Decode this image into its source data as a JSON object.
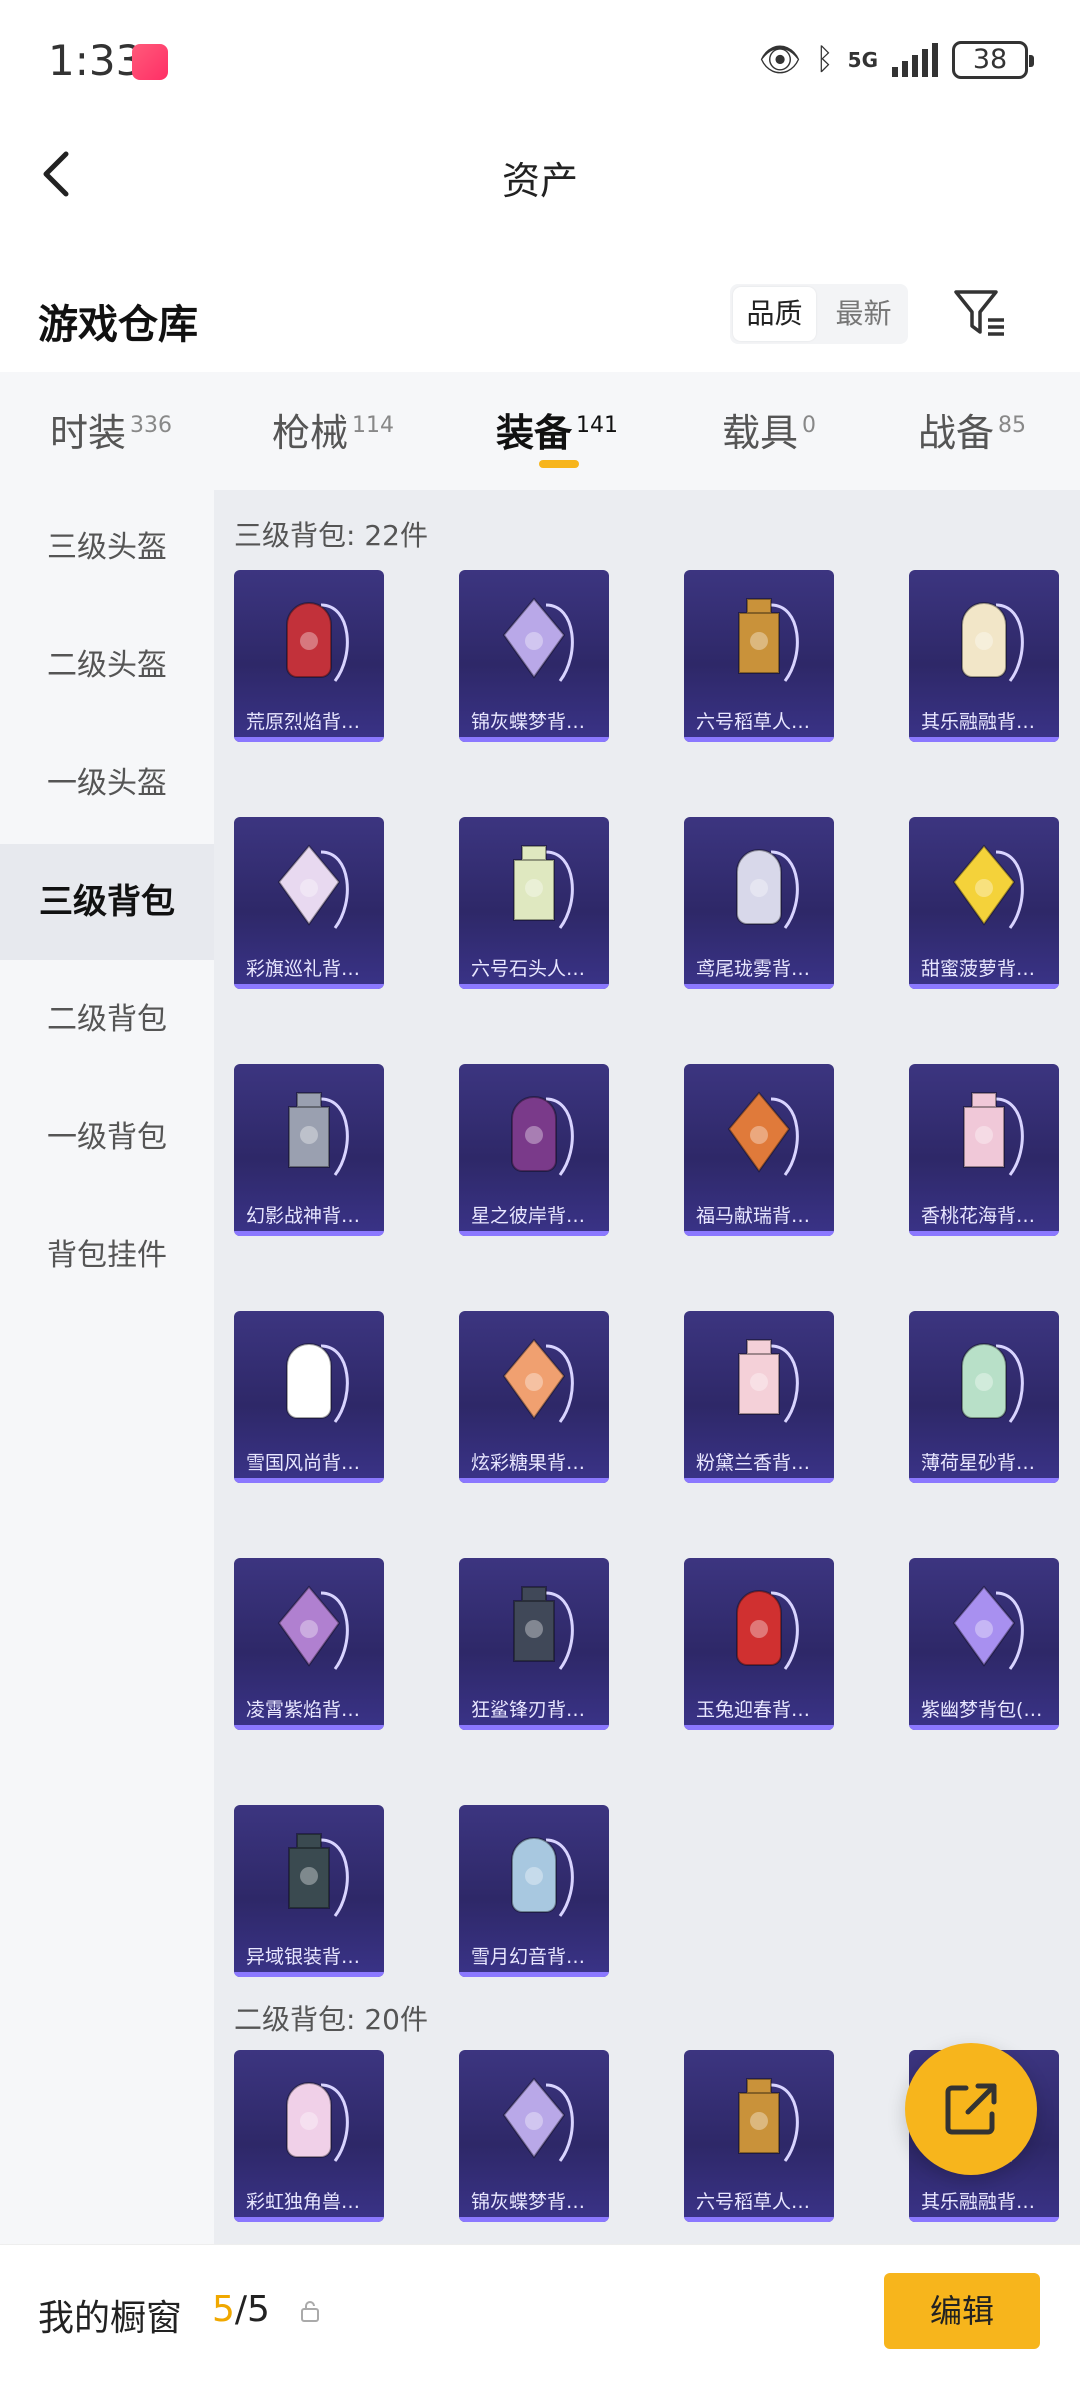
{
  "status": {
    "time": "1:33",
    "network": "5G",
    "battery": "38"
  },
  "nav": {
    "title": "资产"
  },
  "warehouse": {
    "title": "游戏仓库",
    "sort_options": [
      "品质",
      "最新"
    ],
    "active_sort": "品质"
  },
  "tabs": [
    {
      "label": "时装",
      "count": "336"
    },
    {
      "label": "枪械",
      "count": "114"
    },
    {
      "label": "装备",
      "count": "141"
    },
    {
      "label": "载具",
      "count": "0"
    },
    {
      "label": "战备",
      "count": "85"
    }
  ],
  "active_tab": "装备",
  "sidebar": {
    "items": [
      "三级头盔",
      "二级头盔",
      "一级头盔",
      "三级背包",
      "二级背包",
      "一级背包",
      "背包挂件"
    ],
    "active": "三级背包"
  },
  "groups": [
    {
      "title": "三级背包: 22件",
      "items": [
        "荒原烈焰背…",
        "锦灰蝶梦背…",
        "六号稻草人…",
        "其乐融融背…",
        "彩旗巡礼背…",
        "六号石头人…",
        "鸢尾珑雾背…",
        "甜蜜菠萝背…",
        "幻影战神背…",
        "星之彼岸背…",
        "福马献瑞背…",
        "香桃花海背…",
        "雪国风尚背…",
        "炫彩糖果背…",
        "粉黛兰香背…",
        "薄荷星砂背…",
        "凌霄紫焰背…",
        "狂鲨锋刃背…",
        "玉兔迎春背…",
        "紫幽梦背包(…",
        "异域银装背…",
        "雪月幻音背…"
      ]
    },
    {
      "title": "二级背包: 20件",
      "items": [
        "彩虹独角兽…",
        "锦灰蝶梦背…",
        "六号稻草人…",
        "其乐融融背…"
      ]
    }
  ],
  "item_colors": [
    "#c2313a",
    "#b9a8e8",
    "#c9923a",
    "#f2e6c8",
    "#e8d9f0",
    "#dfe8c0",
    "#d8d8ea",
    "#f4d23a",
    "#9aa0b0",
    "#7a3a8a",
    "#e07a3a",
    "#f0c8d8",
    "#ffffff",
    "#f0a070",
    "#f4d0d8",
    "#b8e0c8",
    "#b080d0",
    "#404858",
    "#d03030",
    "#a890f0",
    "#3a4a50",
    "#a8c8e0",
    "#f0d0e8",
    "#b9a8e8",
    "#c9923a",
    "#f2e6c8"
  ],
  "bottom": {
    "label": "我的橱窗",
    "current": "5",
    "total": "/5",
    "edit_label": "编辑"
  }
}
